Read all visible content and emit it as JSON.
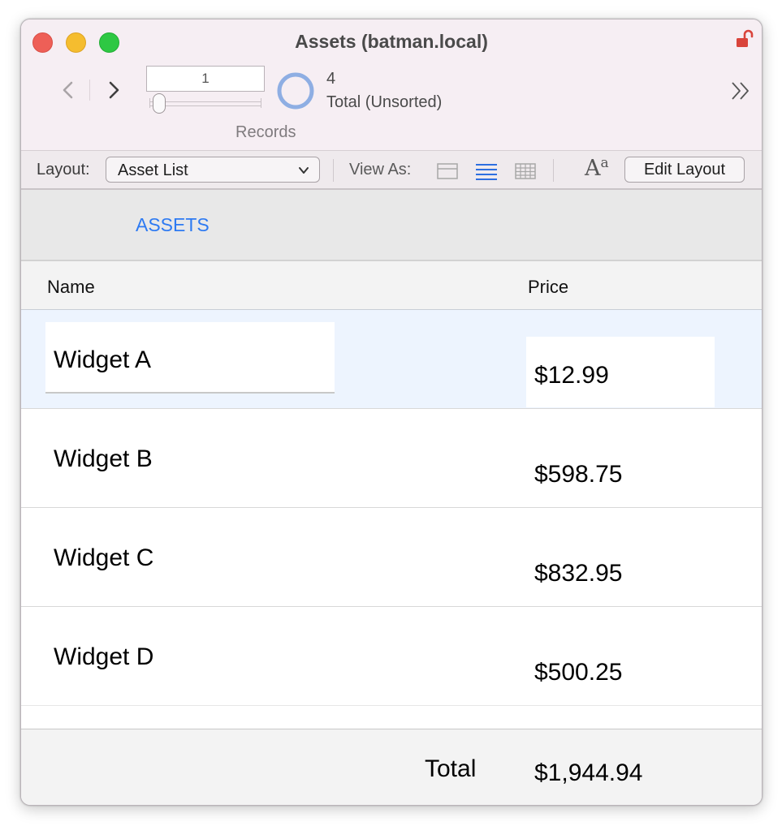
{
  "window": {
    "title": "Assets (batman.local)"
  },
  "toolbar": {
    "current_record": "1",
    "records_label": "Records",
    "found_count": "4",
    "found_status": "Total (Unsorted)"
  },
  "layoutbar": {
    "layout_label": "Layout:",
    "layout_selected": "Asset List",
    "view_as_label": "View As:",
    "font_icon_big": "A",
    "font_icon_small": "a",
    "edit_layout_label": "Edit Layout"
  },
  "header": {
    "title": "ASSETS"
  },
  "columns": {
    "name": "Name",
    "price": "Price"
  },
  "rows": [
    {
      "name": "Widget A",
      "price": "$12.99"
    },
    {
      "name": "Widget B",
      "price": "$598.75"
    },
    {
      "name": "Widget C",
      "price": "$832.95"
    },
    {
      "name": "Widget D",
      "price": "$500.25"
    }
  ],
  "footer": {
    "total_label": "Total",
    "total_value": "$1,944.94"
  },
  "colors": {
    "titlebar_bg": "#f6eef3",
    "accent_blue": "#2d7af2",
    "active_row_bg": "#edf4fe",
    "lock_red": "#d9443b"
  },
  "icons": {
    "lock": "unlocked-padlock-icon",
    "prev": "chevron-left-icon",
    "next": "chevron-right-icon",
    "found_set": "pie-chart-icon",
    "more": "double-chevron-right-icon",
    "view_form": "form-view-icon",
    "view_list": "list-view-icon",
    "view_table": "table-view-icon"
  }
}
